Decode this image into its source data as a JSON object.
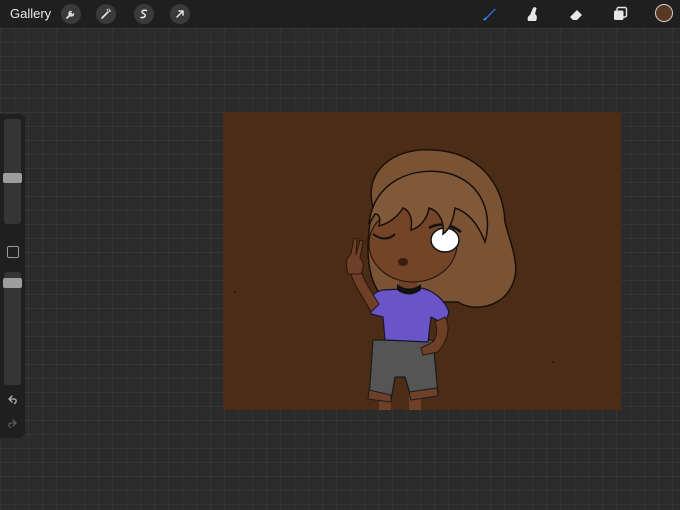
{
  "topbar": {
    "gallery_label": "Gallery",
    "left_tools": [
      "wrench-icon",
      "magic-wand-icon",
      "selection-icon",
      "transform-arrow-icon"
    ],
    "right_tools": [
      "brush-icon",
      "smudge-icon",
      "eraser-icon",
      "layers-icon"
    ],
    "active_tool": "brush-icon",
    "current_color": "#5a3722"
  },
  "sidebar": {
    "brush_size_level": 0.62,
    "opacity_level": 0.84,
    "modify_button": "square-icon",
    "undo_icon": "undo-icon",
    "redo_icon": "redo-icon"
  },
  "canvas": {
    "background_color": "#4a2c17",
    "artwork": "chibi-character-drawing"
  },
  "colors": {
    "accent": "#2f7cf6",
    "panel": "#1f1f1f",
    "workspace": "#2b2b2b"
  }
}
